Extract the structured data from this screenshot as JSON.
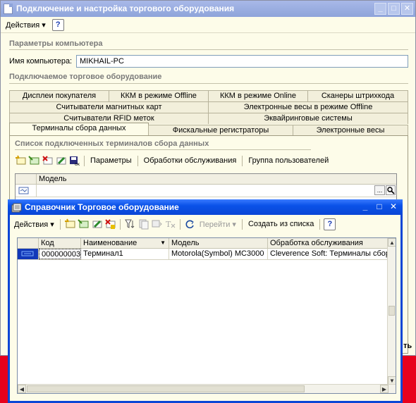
{
  "main_window": {
    "title": "Подключение и настройка торгового оборудования",
    "toolbar": {
      "actions_label": "Действия",
      "help_label": "?"
    },
    "computer_section": {
      "title": "Параметры компьютера",
      "name_label": "Имя компьютера:",
      "name_value": "MIKHAIL-PC"
    },
    "equipment_section": {
      "title": "Подключаемое торговое оборудование"
    },
    "tabs": {
      "row1": [
        "Дисплеи покупателя",
        "ККМ в режиме Offline",
        "ККМ в режиме Online",
        "Сканеры штрихкода"
      ],
      "row2": [
        "Считыватели магнитных карт",
        "Электронные весы в режиме Offline"
      ],
      "row3": [
        "Считыватели RFID меток",
        "Эквайринговые системы"
      ],
      "row4": [
        "Терминалы сбора данных",
        "Фискальные регистраторы",
        "Электронные весы"
      ],
      "active": "Терминалы сбора данных"
    },
    "list_section": {
      "title": "Список подключенных терминалов сбора данных",
      "toolbar": {
        "params_label": "Параметры",
        "processing_label": "Обработки обслуживания",
        "users_group_label": "Группа пользователей"
      },
      "grid": {
        "column_model": "Модель"
      }
    },
    "partial_button_text": "ть"
  },
  "dialog": {
    "title": "Справочник Торговое оборудование",
    "toolbar": {
      "actions_label": "Действия",
      "goto_label": "Перейти",
      "create_from_list_label": "Создать из списка",
      "help_label": "?"
    },
    "columns": [
      "Код",
      "Наименование",
      "Модель",
      "Обработка обслуживания"
    ],
    "rows": [
      {
        "code": "000000003",
        "name": "Терминал1",
        "model": "Motorola(Symbol) MC3000",
        "processing": "Cleverence Soft: Терминалы сбор"
      }
    ]
  },
  "colors": {
    "dialog_title_blue": "#0a46d6",
    "window_background": "#fdfce9",
    "desktop_red": "#e8001c"
  }
}
